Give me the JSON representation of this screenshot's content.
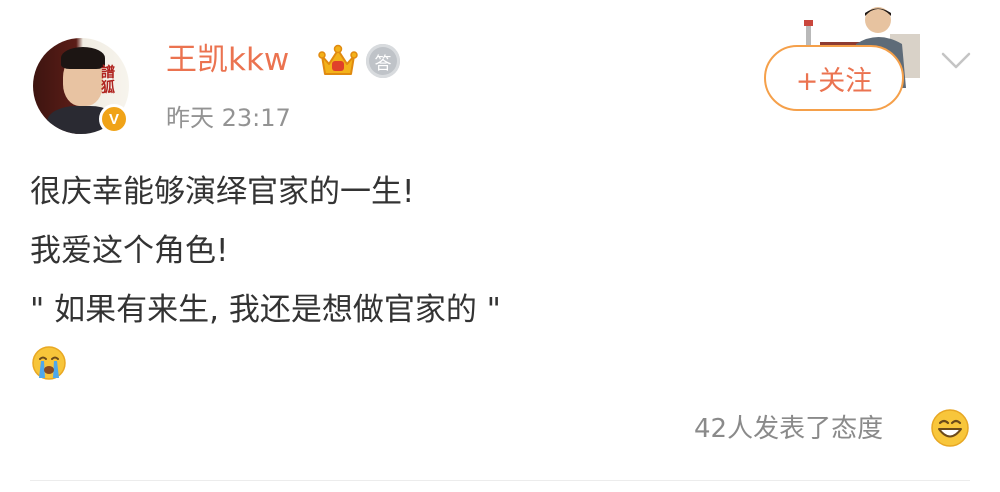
{
  "post": {
    "author": {
      "name": "王凯kkw",
      "verified_badge": "V",
      "crown_icon": "crown-icon",
      "medal_icon": "medal-icon",
      "medal_glyph": "答",
      "avatar_calligraphy": "譜狐"
    },
    "timestamp": "昨天 23:17",
    "follow_label": "+关注",
    "content_lines": [
      "很庆幸能够演绎官家的一生!",
      "我爱这个角色!",
      "\" 如果有来生, 我还是想做官家的 \""
    ],
    "content_emoji": "crying-emoji",
    "reactions_text": "42人发表了态度",
    "reaction_icon": "smiling-emoji",
    "menu_icon": "chevron-down-icon"
  },
  "colors": {
    "accent": "#eb7350",
    "follow_border": "#f5a04a",
    "verified": "#f0a318",
    "muted_text": "#939393",
    "body_text": "#333333"
  }
}
